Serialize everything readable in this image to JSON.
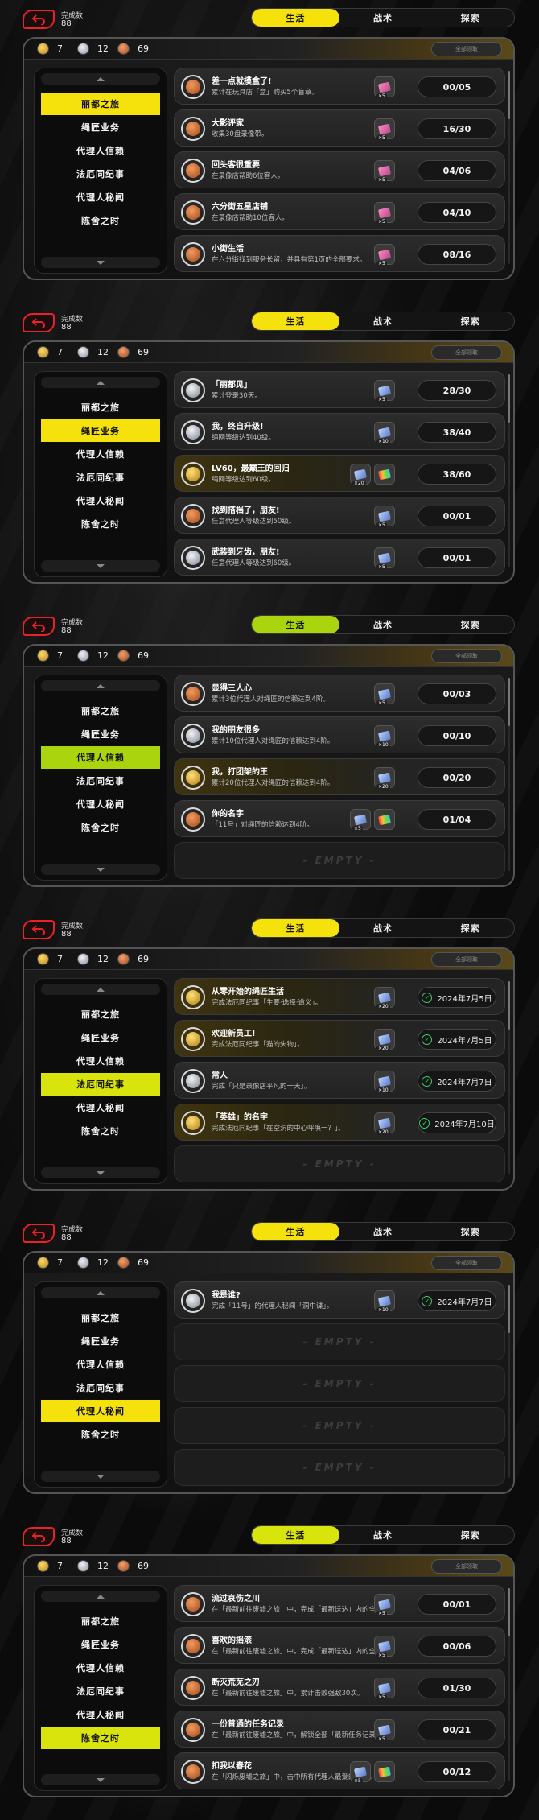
{
  "colors": {
    "yellow": "#f5e20c",
    "lime": "#a9d40e",
    "yellow_pale": "#d8e40c"
  },
  "screens": [
    {
      "active_tab": 0,
      "active_side": 0,
      "tab_color": "#f5e20c",
      "side_color": "#f5e20c",
      "completion_label": "完成数",
      "completion_count": "88",
      "tabs": [
        "生活",
        "战术",
        "探索"
      ],
      "currency": [
        "7",
        "12",
        "69"
      ],
      "claim_all": "全部领取",
      "sidebar": [
        "丽都之旅",
        "绳匠业务",
        "代理人信赖",
        "法厄同纪事",
        "代理人秘闻",
        "陈舍之时"
      ],
      "tasks": [
        {
          "medal": "bronze",
          "title": "差一点就摸盒了!",
          "desc": "累计在玩具店「盒」购买5个盲章。",
          "rewards": [
            {
              "c": "pink",
              "q": "×5"
            }
          ],
          "progress": "00/05"
        },
        {
          "medal": "bronze",
          "title": "大影评家",
          "desc": "收集30盘录像带。",
          "rewards": [
            {
              "c": "pink",
              "q": "×5"
            }
          ],
          "progress": "16/30"
        },
        {
          "medal": "bronze",
          "title": "回头客很重要",
          "desc": "在录像店帮助6位客人。",
          "rewards": [
            {
              "c": "pink",
              "q": "×5"
            }
          ],
          "progress": "04/06"
        },
        {
          "medal": "bronze",
          "title": "六分街五星店铺",
          "desc": "在录像店帮助10位客人。",
          "rewards": [
            {
              "c": "pink",
              "q": "×5"
            }
          ],
          "progress": "04/10"
        },
        {
          "medal": "bronze",
          "title": "小街生活",
          "desc": "在六分街找到服务长留，并具有第1页的全部要求。",
          "rewards": [
            {
              "c": "pink",
              "q": "×5"
            }
          ],
          "progress": "08/16"
        }
      ]
    },
    {
      "active_tab": 0,
      "active_side": 1,
      "tab_color": "#f5e20c",
      "side_color": "#f5e20c",
      "completion_label": "完成数",
      "completion_count": "88",
      "tabs": [
        "生活",
        "战术",
        "探索"
      ],
      "currency": [
        "7",
        "12",
        "69"
      ],
      "claim_all": "全部领取",
      "sidebar": [
        "丽都之旅",
        "绳匠业务",
        "代理人信赖",
        "法厄同纪事",
        "代理人秘闻",
        "陈舍之时"
      ],
      "tasks": [
        {
          "medal": "silver",
          "title": "「丽都见」",
          "desc": "累计登录30天。",
          "rewards": [
            {
              "c": "blue",
              "q": "×5"
            }
          ],
          "progress": "28/30"
        },
        {
          "medal": "silver",
          "title": "我，终自升级!",
          "desc": "绳网等级达到40级。",
          "rewards": [
            {
              "c": "blue",
              "q": "×10"
            }
          ],
          "progress": "38/40"
        },
        {
          "medal": "gold",
          "title": "LV60，最巅王的回归",
          "desc": "绳网等级达到60级。",
          "rewards": [
            {
              "c": "blue",
              "q": "×20"
            },
            {
              "c": "rainbow",
              "q": ""
            }
          ],
          "progress": "38/60"
        },
        {
          "medal": "bronze",
          "title": "找到搭档了，朋友!",
          "desc": "任意代理人等级达到50级。",
          "rewards": [
            {
              "c": "blue",
              "q": "×5"
            }
          ],
          "progress": "00/01"
        },
        {
          "medal": "silver",
          "title": "武装到牙齿，朋友!",
          "desc": "任意代理人等级达到60级。",
          "rewards": [
            {
              "c": "blue",
              "q": "×5"
            }
          ],
          "progress": "00/01"
        }
      ]
    },
    {
      "active_tab": 0,
      "active_side": 2,
      "tab_color": "#a9d40e",
      "side_color": "#a9d40e",
      "completion_label": "完成数",
      "completion_count": "88",
      "tabs": [
        "生活",
        "战术",
        "探索"
      ],
      "currency": [
        "7",
        "12",
        "69"
      ],
      "claim_all": "全部领取",
      "sidebar": [
        "丽都之旅",
        "绳匠业务",
        "代理人信赖",
        "法厄同纪事",
        "代理人秘闻",
        "陈舍之时"
      ],
      "tasks": [
        {
          "medal": "bronze",
          "title": "显得三人心",
          "desc": "累计3位代理人对绳匠的信赖达到4阶。",
          "rewards": [
            {
              "c": "blue",
              "q": "×5"
            }
          ],
          "progress": "00/03"
        },
        {
          "medal": "silver",
          "title": "我的朋友很多",
          "desc": "累计10位代理人对绳匠的信赖达到4阶。",
          "rewards": [
            {
              "c": "blue",
              "q": "×10"
            }
          ],
          "progress": "00/10"
        },
        {
          "medal": "gold",
          "title": "我，打团架的王",
          "desc": "累计20位代理人对绳匠的信赖达到4阶。",
          "rewards": [
            {
              "c": "blue",
              "q": "×20"
            }
          ],
          "progress": "00/20"
        },
        {
          "medal": "bronze",
          "title": "你的名字",
          "desc": "「11号」对绳匠的信赖达到4阶。",
          "rewards": [
            {
              "c": "blue",
              "q": "×5"
            },
            {
              "c": "rainbow",
              "q": ""
            }
          ],
          "progress": "01/04"
        },
        {
          "empty": true,
          "label": "- EMPTY -"
        }
      ]
    },
    {
      "active_tab": 0,
      "active_side": 3,
      "tab_color": "#f5e20c",
      "side_color": "#d8e40c",
      "completion_label": "完成数",
      "completion_count": "88",
      "tabs": [
        "生活",
        "战术",
        "探索"
      ],
      "currency": [
        "7",
        "12",
        "69"
      ],
      "claim_all": "全部领取",
      "sidebar": [
        "丽都之旅",
        "绳匠业务",
        "代理人信赖",
        "法厄同纪事",
        "代理人秘闻",
        "陈舍之时"
      ],
      "tasks": [
        {
          "medal": "gold",
          "title": "从零开始的绳匠生活",
          "desc": "完成法厄同纪事「生要·选择·道义」。",
          "rewards": [
            {
              "c": "blue",
              "q": "×20"
            }
          ],
          "progress": "2024年7月5日",
          "done": true
        },
        {
          "medal": "gold",
          "title": "欢迎新员工!",
          "desc": "完成法厄同纪事「猫的失物」。",
          "rewards": [
            {
              "c": "blue",
              "q": "×20"
            }
          ],
          "progress": "2024年7月5日",
          "done": true
        },
        {
          "medal": "silver",
          "title": "常人",
          "desc": "完成「只是录像店平凡的一天」。",
          "rewards": [
            {
              "c": "blue",
              "q": "×10"
            }
          ],
          "progress": "2024年7月7日",
          "done": true
        },
        {
          "medal": "gold",
          "title": "「英雄」的名字",
          "desc": "完成法厄同纪事「在空洞的中心呼唤一？」。",
          "rewards": [
            {
              "c": "blue",
              "q": "×20"
            }
          ],
          "progress": "2024年7月10日",
          "done": true
        },
        {
          "empty": true,
          "label": "- EMPTY -"
        }
      ]
    },
    {
      "active_tab": 0,
      "active_side": 4,
      "tab_color": "#f5e20c",
      "side_color": "#f5e20c",
      "completion_label": "完成数",
      "completion_count": "88",
      "tabs": [
        "生活",
        "战术",
        "探索"
      ],
      "currency": [
        "7",
        "12",
        "69"
      ],
      "claim_all": "全部领取",
      "sidebar": [
        "丽都之旅",
        "绳匠业务",
        "代理人信赖",
        "法厄同纪事",
        "代理人秘闻",
        "陈舍之时"
      ],
      "tasks": [
        {
          "medal": "silver",
          "title": "我是谁?",
          "desc": "完成「11号」的代理人秘闻「洞中谍」。",
          "rewards": [
            {
              "c": "blue",
              "q": "×10"
            }
          ],
          "progress": "2024年7月7日",
          "done": true
        },
        {
          "empty": true,
          "label": "- EMPTY -"
        },
        {
          "empty": true,
          "label": "- EMPTY -"
        },
        {
          "empty": true,
          "label": "- EMPTY -"
        },
        {
          "empty": true,
          "label": "- EMPTY -"
        }
      ]
    },
    {
      "active_tab": 0,
      "active_side": 5,
      "tab_color": "#d8e40c",
      "side_color": "#d8e40c",
      "completion_label": "完成数",
      "completion_count": "88",
      "tabs": [
        "生活",
        "战术",
        "探索"
      ],
      "currency": [
        "7",
        "12",
        "69"
      ],
      "claim_all": "全部领取",
      "sidebar": [
        "丽都之旅",
        "绳匠业务",
        "代理人信赖",
        "法厄同纪事",
        "代理人秘闻",
        "陈舍之时"
      ],
      "tasks": [
        {
          "medal": "bronze",
          "title": "流过哀伤之川",
          "desc": "在「最新前往废墟之旅」中，完成「最新送达」内的全部关卡通关。",
          "rewards": [
            {
              "c": "blue",
              "q": "×5"
            }
          ],
          "progress": "00/01"
        },
        {
          "medal": "bronze",
          "title": "喜欢的摇滚",
          "desc": "在「最新前往废墟之旅」中，完成「最新送达」内的全部关卡通关。",
          "rewards": [
            {
              "c": "blue",
              "q": "×5"
            }
          ],
          "progress": "00/06"
        },
        {
          "medal": "bronze",
          "title": "断灭荒芜之刃",
          "desc": "在「最新前往废墟之旅」中，累计击败强敌30次。",
          "rewards": [
            {
              "c": "blue",
              "q": "×5"
            }
          ],
          "progress": "01/30"
        },
        {
          "medal": "bronze",
          "title": "一份普通的任务记录",
          "desc": "在「最新前往废墟之旅」中，解锁全部「最新任务记录」。",
          "rewards": [
            {
              "c": "blue",
              "q": "×5"
            }
          ],
          "progress": "00/21"
        },
        {
          "medal": "bronze",
          "title": "扣我以春花",
          "desc": "在「闪烁废墟之旅」中，击中所有代理人最爱的互补。",
          "rewards": [
            {
              "c": "blue",
              "q": "×5"
            },
            {
              "c": "rainbow",
              "q": ""
            }
          ],
          "progress": "00/12"
        }
      ]
    }
  ]
}
